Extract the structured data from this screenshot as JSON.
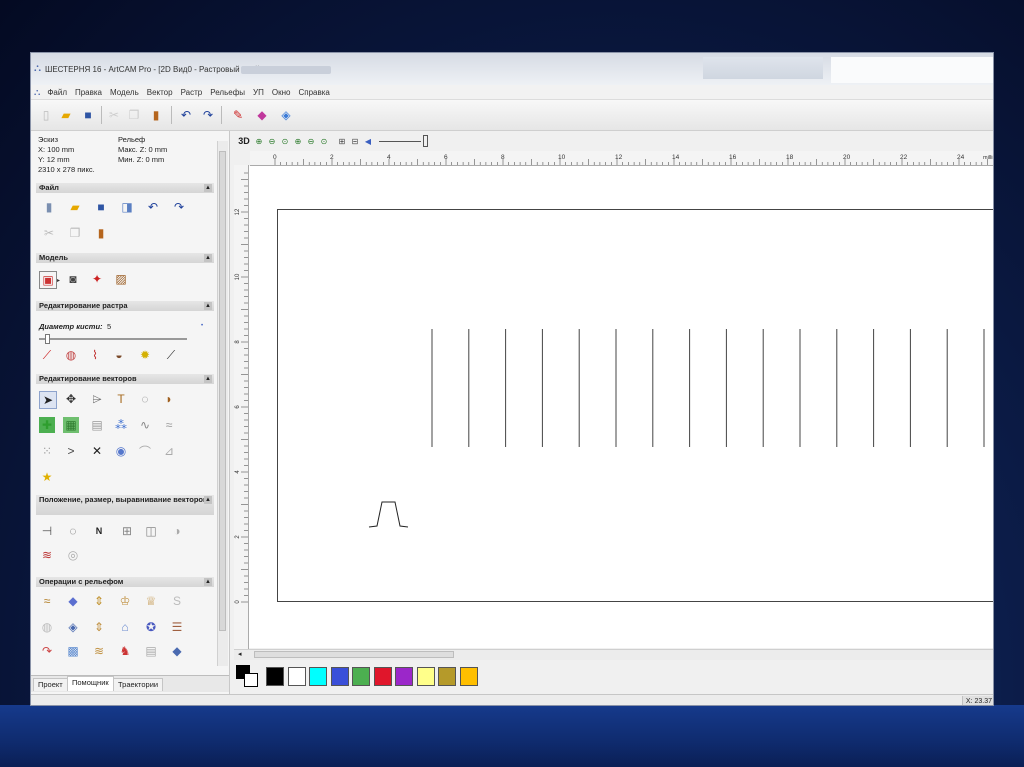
{
  "window": {
    "title": "ШЕСТЕРНЯ 16 - ArtCAM Pro - [2D Вид0 - Растровый слой]"
  },
  "menu": [
    "Файл",
    "Правка",
    "Модель",
    "Вектор",
    "Растр",
    "Рельефы",
    "УП",
    "Окно",
    "Справка"
  ],
  "info": {
    "sketch_label": "Эскиз",
    "x": "X: 100 mm",
    "y": "Y: 12 mm",
    "pixels": "2310 x 278 пикс.",
    "relief_label": "Рельеф",
    "max_z": "Макс. Z: 0 mm",
    "min_z": "Мин. Z: 0 mm"
  },
  "sections": {
    "file": "Файл",
    "model": "Модель",
    "raster_edit": "Редактирование растра",
    "vector_edit": "Редактирование векторов",
    "position": "Положение, размер, выравнивание векторов",
    "relief_ops": "Операции с рельефом"
  },
  "brush": {
    "label": "Диаметр кисти:",
    "value": "5"
  },
  "tabs": [
    "Проект",
    "Помощник",
    "Траектории"
  ],
  "view_toolbar": {
    "mode_3d": "3D"
  },
  "ruler": {
    "top_ticks": [
      "0",
      "2",
      "4",
      "6",
      "8",
      "10",
      "12",
      "14",
      "16",
      "18",
      "20",
      "22",
      "24"
    ],
    "top_unit": "millim",
    "left_ticks": [
      "12",
      "10",
      "8",
      "6",
      "4",
      "2",
      "0"
    ]
  },
  "palette": [
    "#000000",
    "#ffffff",
    "#00ffff",
    "#3a4fd8",
    "#4caf50",
    "#e0162b",
    "#9b27c9",
    "#ffff8a",
    "#b59a2a",
    "#ffbf00"
  ],
  "status": {
    "coord": "X: 23.37"
  }
}
